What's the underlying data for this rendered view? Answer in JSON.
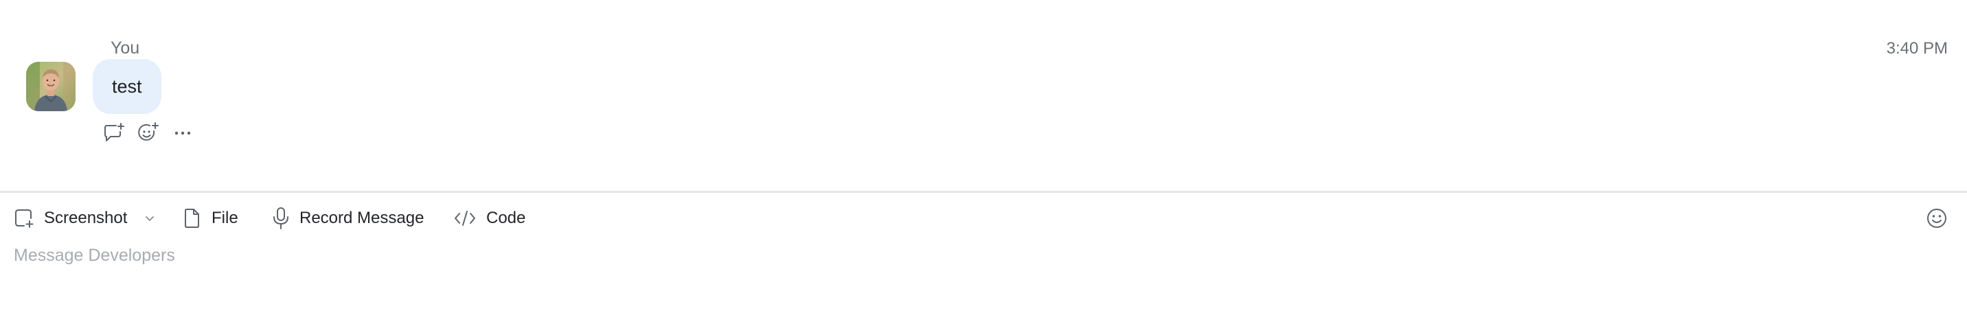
{
  "message": {
    "sender": "You",
    "timestamp": "3:40 PM",
    "text": "test",
    "avatar_icon": "user-avatar-photo",
    "actions": [
      "reply-in-thread-icon",
      "add-reaction-icon",
      "more-options-icon"
    ]
  },
  "composer": {
    "toolbar": {
      "screenshot_label": "Screenshot",
      "file_label": "File",
      "record_label": "Record Message",
      "code_label": "Code"
    },
    "placeholder": "Message Developers"
  },
  "colors": {
    "bubble": "#e6effc",
    "muted_text": "#6b6f76",
    "placeholder": "#a8abb1",
    "divider": "#e7e8eb"
  }
}
